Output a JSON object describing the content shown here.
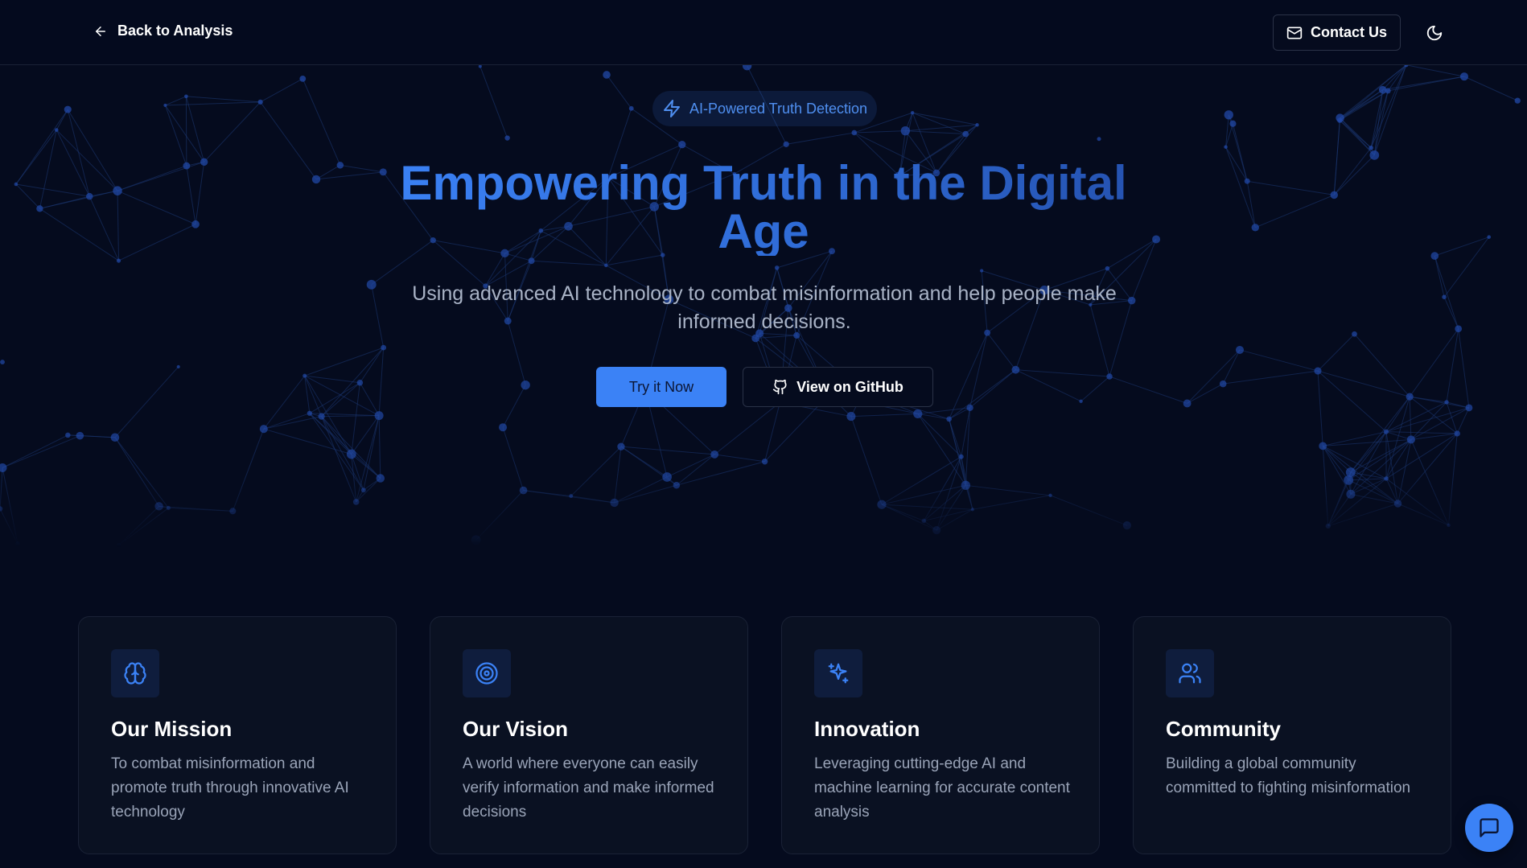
{
  "header": {
    "back_label": "Back to Analysis",
    "contact_label": "Contact Us"
  },
  "hero": {
    "badge": "AI-Powered Truth Detection",
    "title": "Empowering Truth in the Digital Age",
    "subtitle": "Using advanced AI technology to combat misinformation and help people make informed decisions.",
    "primary_button": "Try it Now",
    "secondary_button": "View on GitHub"
  },
  "cards": [
    {
      "icon": "brain-icon",
      "title": "Our Mission",
      "description": "To combat misinformation and promote truth through innovative AI technology"
    },
    {
      "icon": "target-icon",
      "title": "Our Vision",
      "description": "A world where everyone can easily verify information and make informed decisions"
    },
    {
      "icon": "sparkles-icon",
      "title": "Innovation",
      "description": "Leveraging cutting-edge AI and machine learning for accurate content analysis"
    },
    {
      "icon": "users-icon",
      "title": "Community",
      "description": "Building a global community committed to fighting misinformation"
    }
  ],
  "colors": {
    "background": "#050b1e",
    "accent": "#3b82f6",
    "card_background": "#0a1122",
    "muted_text": "#9aa4b8"
  }
}
